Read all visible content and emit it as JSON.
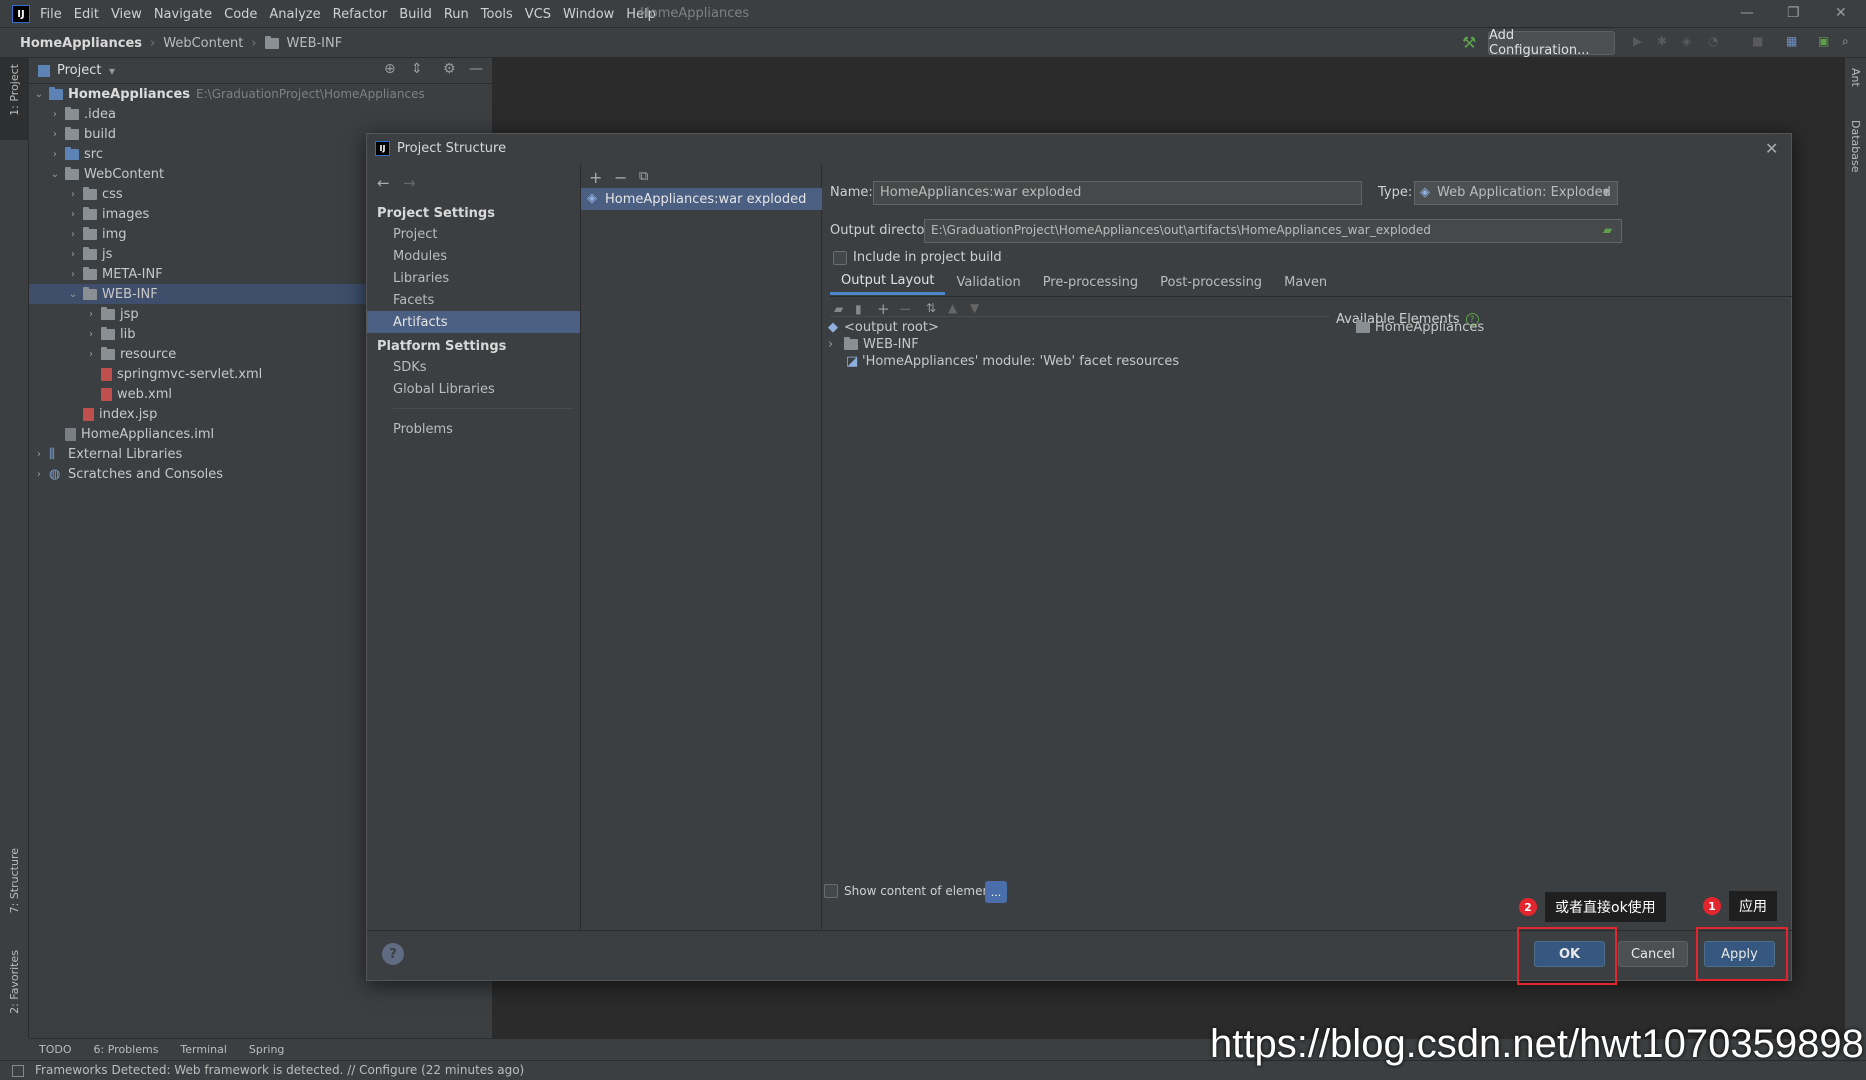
{
  "menubar": {
    "logo": "IJ",
    "items": [
      "File",
      "Edit",
      "View",
      "Navigate",
      "Code",
      "Analyze",
      "Refactor",
      "Build",
      "Run",
      "Tools",
      "VCS",
      "Window",
      "Help"
    ],
    "project_title": "HomeAppliances"
  },
  "breadcrumb": {
    "items": [
      "HomeAppliances",
      "WebContent",
      "WEB-INF"
    ]
  },
  "toolbar": {
    "add_configuration": "Add Configuration..."
  },
  "left_strip": {
    "project_tab": "1: Project",
    "structure_tab": "7: Structure",
    "favorites_tab": "2: Favorites"
  },
  "right_strip": {
    "ant_tab": "Ant",
    "database_tab": "Database"
  },
  "project_panel": {
    "title": "Project",
    "root": {
      "name": "HomeAppliances",
      "path": "E:\\GraduationProject\\HomeAppliances"
    },
    "tree": [
      {
        "label": ".idea"
      },
      {
        "label": "build"
      },
      {
        "label": "src"
      },
      {
        "label": "WebContent"
      },
      {
        "label": "css"
      },
      {
        "label": "images"
      },
      {
        "label": "img"
      },
      {
        "label": "js"
      },
      {
        "label": "META-INF"
      },
      {
        "label": "WEB-INF"
      },
      {
        "label": "jsp"
      },
      {
        "label": "lib"
      },
      {
        "label": "resource"
      },
      {
        "label": "springmvc-servlet.xml"
      },
      {
        "label": "web.xml"
      },
      {
        "label": "index.jsp"
      },
      {
        "label": "HomeAppliances.iml"
      },
      {
        "label": "External Libraries"
      },
      {
        "label": "Scratches and Consoles"
      }
    ]
  },
  "dialog": {
    "title": "Project Structure",
    "project_settings_header": "Project Settings",
    "project_settings": [
      "Project",
      "Modules",
      "Libraries",
      "Facets",
      "Artifacts"
    ],
    "platform_settings_header": "Platform Settings",
    "platform_settings": [
      "SDKs",
      "Global Libraries"
    ],
    "problems": "Problems",
    "artifact": "HomeAppliances:war exploded",
    "name_label": "Name:",
    "name_value": "HomeAppliances:war exploded",
    "type_label": "Type:",
    "type_value": "Web Application: Exploded",
    "output_dir_label": "Output directory:",
    "output_dir_value": "E:\\GraduationProject\\HomeAppliances\\out\\artifacts\\HomeAppliances_war_exploded",
    "include_build": "Include in project build",
    "tabs": [
      "Output Layout",
      "Validation",
      "Pre-processing",
      "Post-processing",
      "Maven"
    ],
    "output_tree": [
      "<output root>",
      "WEB-INF",
      "'HomeAppliances' module: 'Web' facet resources"
    ],
    "available_elements_label": "Available Elements",
    "available_elements": [
      "HomeAppliances"
    ],
    "show_content": "Show content of elements",
    "dots": "...",
    "ok": "OK",
    "cancel": "Cancel",
    "apply": "Apply",
    "help": "?"
  },
  "annotations": {
    "badge1": "1",
    "tip1": "应用",
    "badge2": "2",
    "tip2": "或者直接ok使用",
    "color": "#e3262d"
  },
  "tool_tabs": [
    "TODO",
    "6: Problems",
    "Terminal",
    "Spring"
  ],
  "status": {
    "text": "Frameworks Detected: Web framework is detected. // Configure (22 minutes ago)"
  },
  "watermark": "https://blog.csdn.net/hwt1070359898",
  "colors": {
    "selection": "#4b5f83",
    "primary_button": "#365880",
    "background": "#3c3f41",
    "editor": "#2b2b2b"
  }
}
